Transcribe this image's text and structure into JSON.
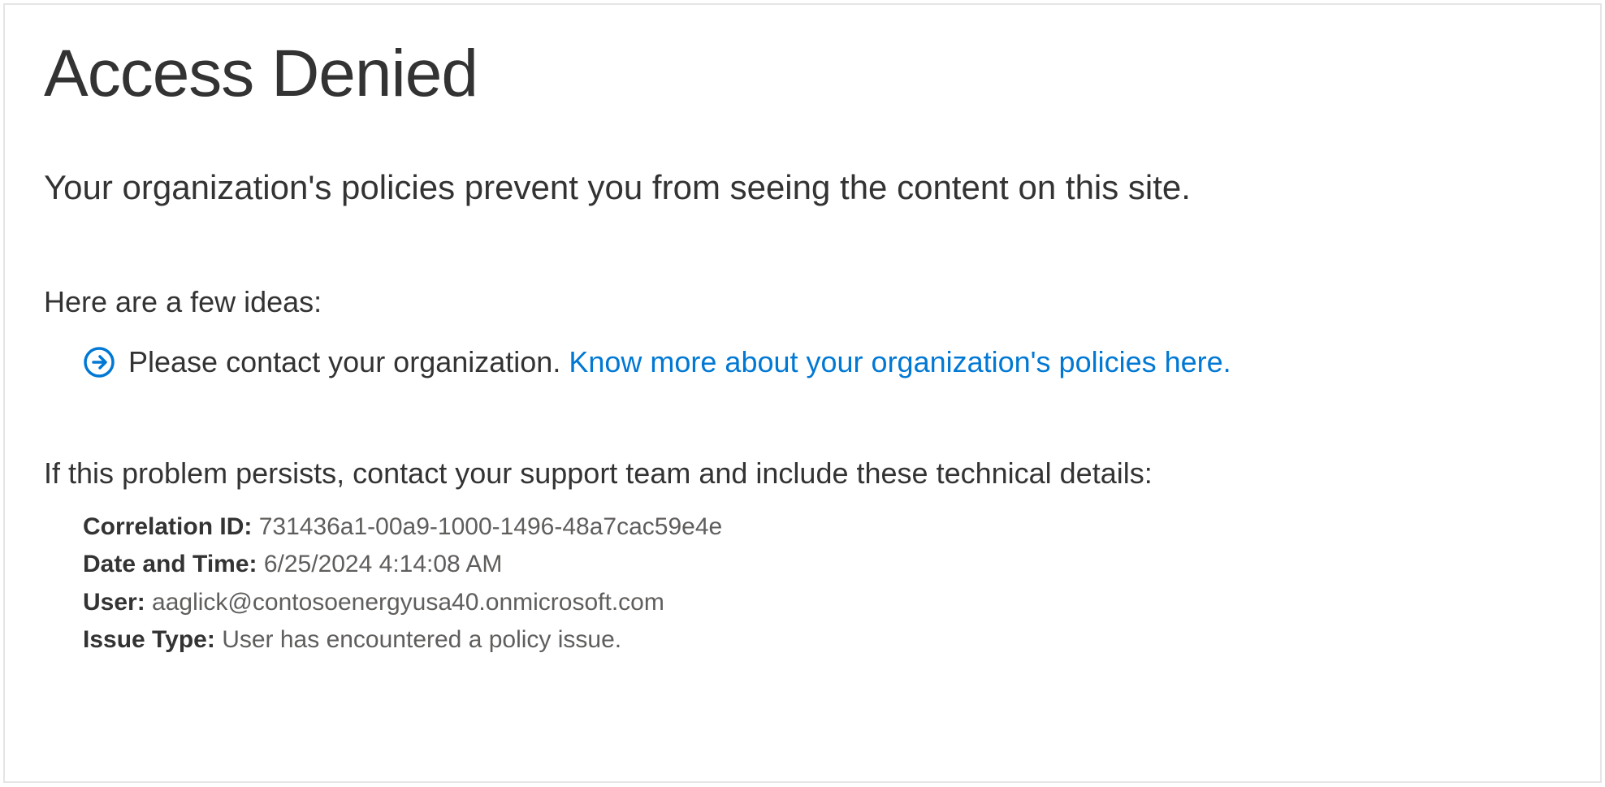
{
  "title": "Access Denied",
  "subtitle": "Your organization's policies prevent you from seeing the content on this site.",
  "ideas_heading": "Here are a few ideas:",
  "idea_text": "Please contact your organization.",
  "policy_link_text": "Know more about your organization's policies here.",
  "persist_heading": "If this problem persists, contact your support team and include these technical details:",
  "details": {
    "correlation_label": "Correlation ID:",
    "correlation_value": "731436a1-00a9-1000-1496-48a7cac59e4e",
    "datetime_label": "Date and Time:",
    "datetime_value": "6/25/2024 4:14:08 AM",
    "user_label": "User:",
    "user_value": "aaglick@contosoenergyusa40.onmicrosoft.com",
    "issuetype_label": "Issue Type:",
    "issuetype_value": "User has encountered a policy issue."
  },
  "colors": {
    "link": "#0078D4",
    "text_primary": "#333333",
    "text_secondary": "#605e5c",
    "border": "#e5e5e5"
  }
}
